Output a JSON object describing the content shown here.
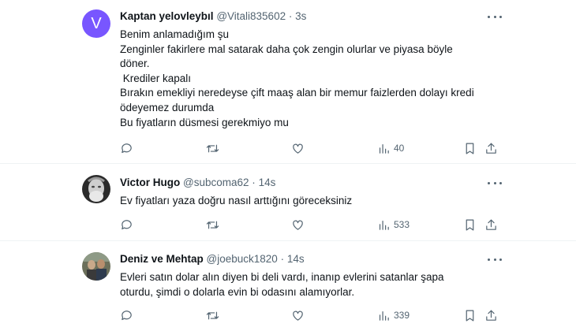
{
  "tweets": [
    {
      "name": "Kaptan yelovleybıl",
      "handle": "@Vitali835602",
      "time": "3s",
      "avatar_letter": "V",
      "lines": [
        "Benim anlamadığım şu",
        "Zenginler fakirlere mal satarak daha çok zengin olurlar ve piyasa böyle döner.",
        " Krediler kapalı",
        "Bırakın emekliyi neredeyse çift maaş alan bir memur faizlerden dolayı kredi ödeyemez durumda",
        "Bu fiyatların düsmesi gerekmiyo mu"
      ],
      "views": "40"
    },
    {
      "name": "Victor Hugo",
      "handle": "@subcoma62",
      "time": "14s",
      "lines": [
        "Ev fiyatları yaza doğru nasıl arttığını göreceksiniz"
      ],
      "views": "533"
    },
    {
      "name": "Deniz ve Mehtap",
      "handle": "@joebuck1820",
      "time": "14s",
      "lines": [
        "Evleri satın dolar alın diyen bi deli vardı, inanıp evlerini satanlar şapa oturdu, şimdi o dolarla evin bi odasını alamıyorlar."
      ],
      "views": "339"
    }
  ],
  "separator": "·",
  "colors": {
    "avatar_v": "#7856ff",
    "text": "#0f1419",
    "secondary": "#536471",
    "divider": "#eff3f4"
  }
}
